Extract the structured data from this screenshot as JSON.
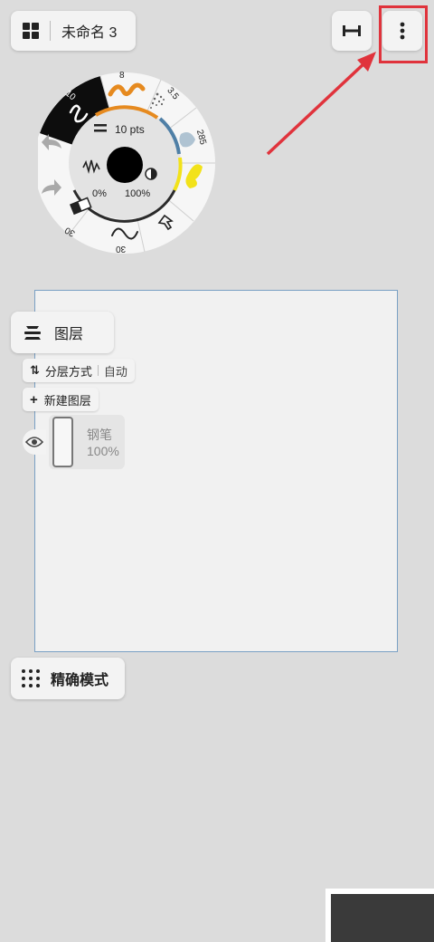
{
  "document": {
    "title": "未命名 3"
  },
  "brush_wheel": {
    "size_label": "10 pts",
    "opacity_min": "0%",
    "opacity_max": "100%",
    "tools": [
      {
        "name": "pen",
        "value": "10"
      },
      {
        "name": "marker",
        "value": "8"
      },
      {
        "name": "airbrush",
        "value": "3.5"
      },
      {
        "name": "watercolor",
        "value": "285"
      },
      {
        "name": "highlighter",
        "value": ""
      },
      {
        "name": "selection",
        "value": ""
      },
      {
        "name": "smooth",
        "value": "30"
      },
      {
        "name": "eraser",
        "value": "30"
      }
    ],
    "colors": {
      "pen_bg": "#0d0d0d",
      "marker": "#e68a1f",
      "highlighter": "#f2e21a",
      "accent": "#4f7fa6",
      "swatch": "#000000"
    }
  },
  "layers": {
    "title": "图层",
    "mode_label": "分层方式",
    "mode_value": "自动",
    "new_layer_label": "新建图层",
    "items": [
      {
        "name": "钢笔",
        "opacity": "100%"
      }
    ]
  },
  "precision": {
    "label": "精确模式"
  },
  "annotation": {
    "color": "#e0333c"
  }
}
